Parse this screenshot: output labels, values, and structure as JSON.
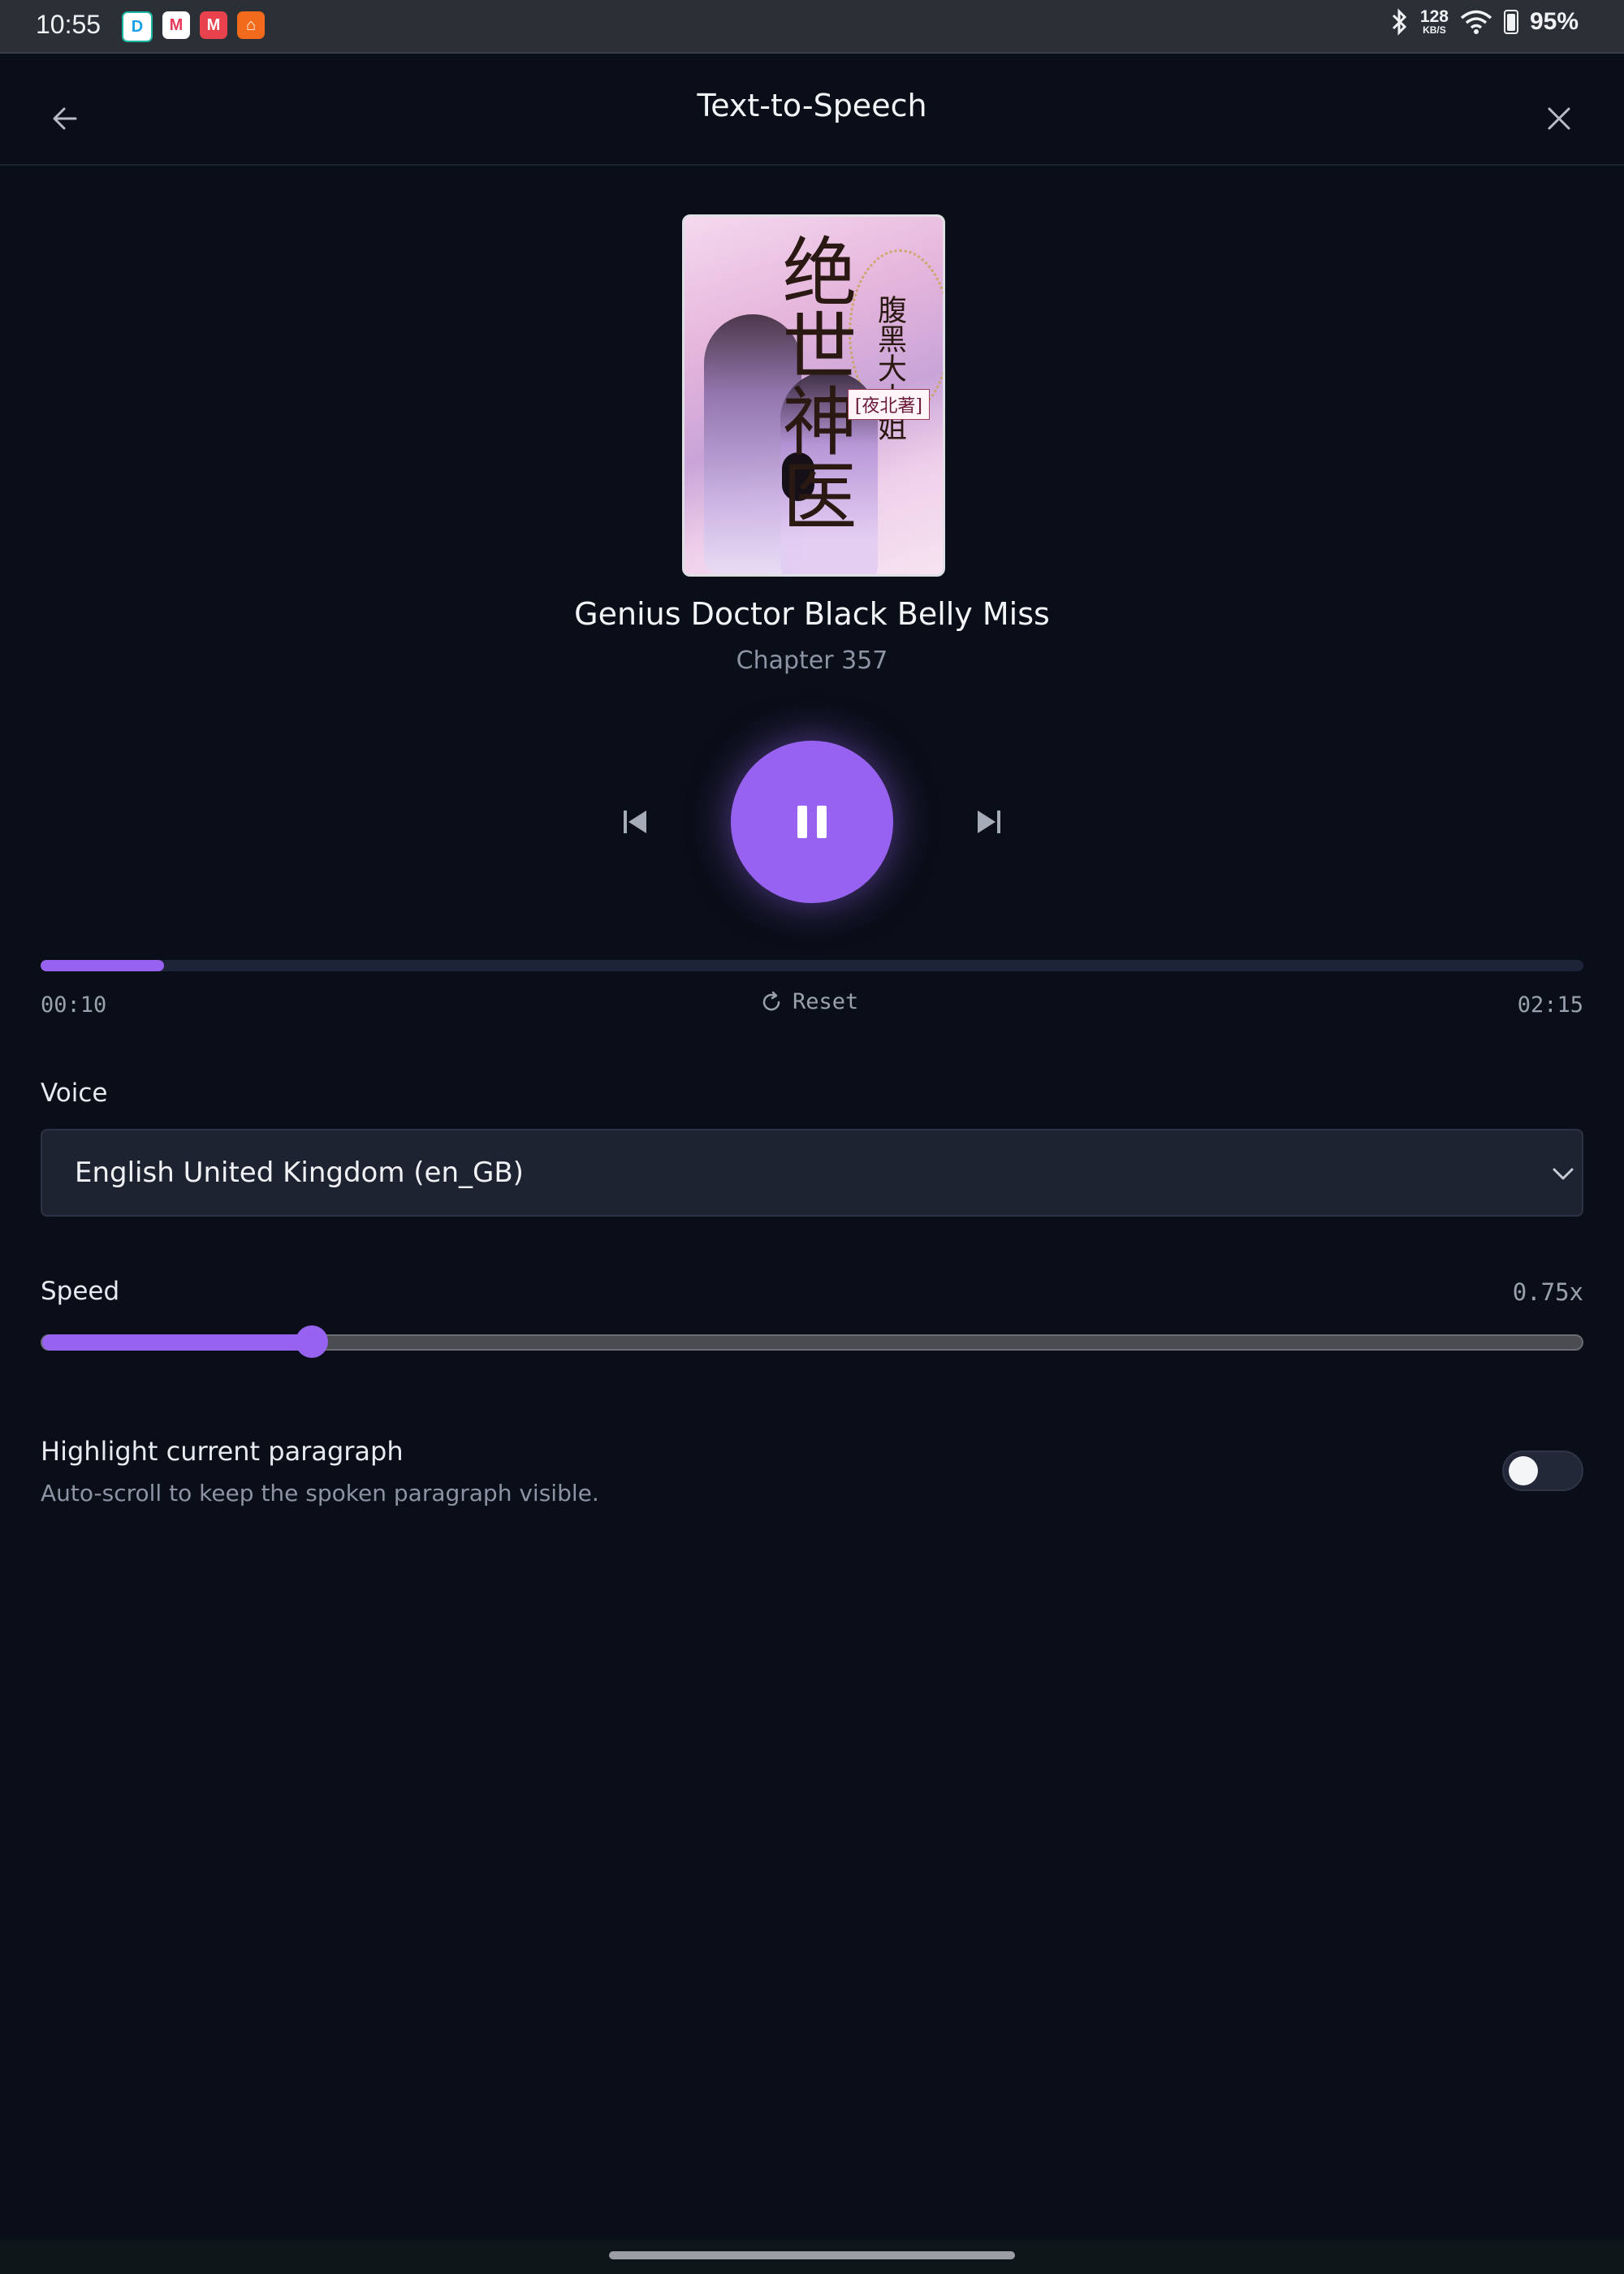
{
  "status_bar": {
    "time": "10:55",
    "apps": [
      "D",
      "M",
      "M",
      "⌂"
    ],
    "net_speed_top": "128",
    "net_speed_bottom": "KB/S",
    "battery": "95%"
  },
  "header": {
    "title": "Text-to-Speech"
  },
  "book": {
    "cover_title": "绝世神医",
    "cover_subtitle": "腹黑大小姐",
    "cover_author": "[夜北著]",
    "title": "Genius Doctor Black Belly Miss",
    "chapter": "Chapter 357"
  },
  "playback": {
    "state": "playing",
    "current_time": "00:10",
    "total_time": "02:15",
    "reset_label": "Reset",
    "progress": 0.08
  },
  "voice": {
    "label": "Voice",
    "selected": "English United Kingdom (en_GB)"
  },
  "speed": {
    "label": "Speed",
    "value_label": "0.75x",
    "slider_fraction": 0.175
  },
  "highlight": {
    "title": "Highlight current paragraph",
    "description": "Auto-scroll to keep the spoken paragraph visible.",
    "enabled": false
  },
  "colors": {
    "accent": "#9662ef",
    "background": "#0a0e18"
  }
}
